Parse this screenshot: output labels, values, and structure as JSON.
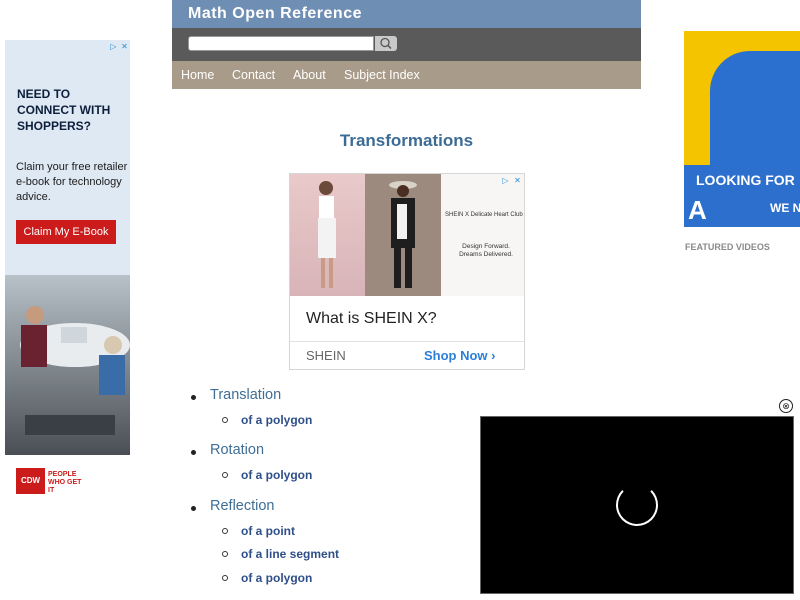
{
  "header": {
    "site_title": "Math Open Reference",
    "search_placeholder": "",
    "nav": [
      "Home",
      "Contact",
      "About",
      "Subject Index"
    ]
  },
  "page_title": "Transformations",
  "center_ad": {
    "brand_line": "SHEIN X Delicate Heart Club",
    "tagline": "Design Forward. Dreams Delivered.",
    "question": "What is SHEIN X?",
    "brand": "SHEIN",
    "cta": "Shop Now"
  },
  "left_ad": {
    "headline": "NEED TO CONNECT WITH SHOPPERS?",
    "body": "Claim your free retailer e-book for technology advice.",
    "button": "Claim My E-Book",
    "logo": "CDW",
    "tagline": "PEOPLE WHO GET IT"
  },
  "right_ad": {
    "headline": "LOOKING FOR",
    "letter": "A",
    "sub": "WE N"
  },
  "featured_videos": "FEATURED VIDEOS",
  "topics": [
    {
      "label": "Translation",
      "items": [
        "of a polygon"
      ]
    },
    {
      "label": "Rotation",
      "items": [
        "of a polygon"
      ]
    },
    {
      "label": "Reflection",
      "items": [
        "of a point",
        "of a line segment",
        "of a polygon"
      ]
    }
  ],
  "video_close": "⊗",
  "icons": {
    "search": "search-icon",
    "close": "close-icon",
    "chevron": "chevron-right-icon"
  },
  "colors": {
    "title_bar": "#6e8eb3",
    "nav_bar": "#a99b89",
    "link": "#3f6e96",
    "cta": "#cc1b1b"
  }
}
